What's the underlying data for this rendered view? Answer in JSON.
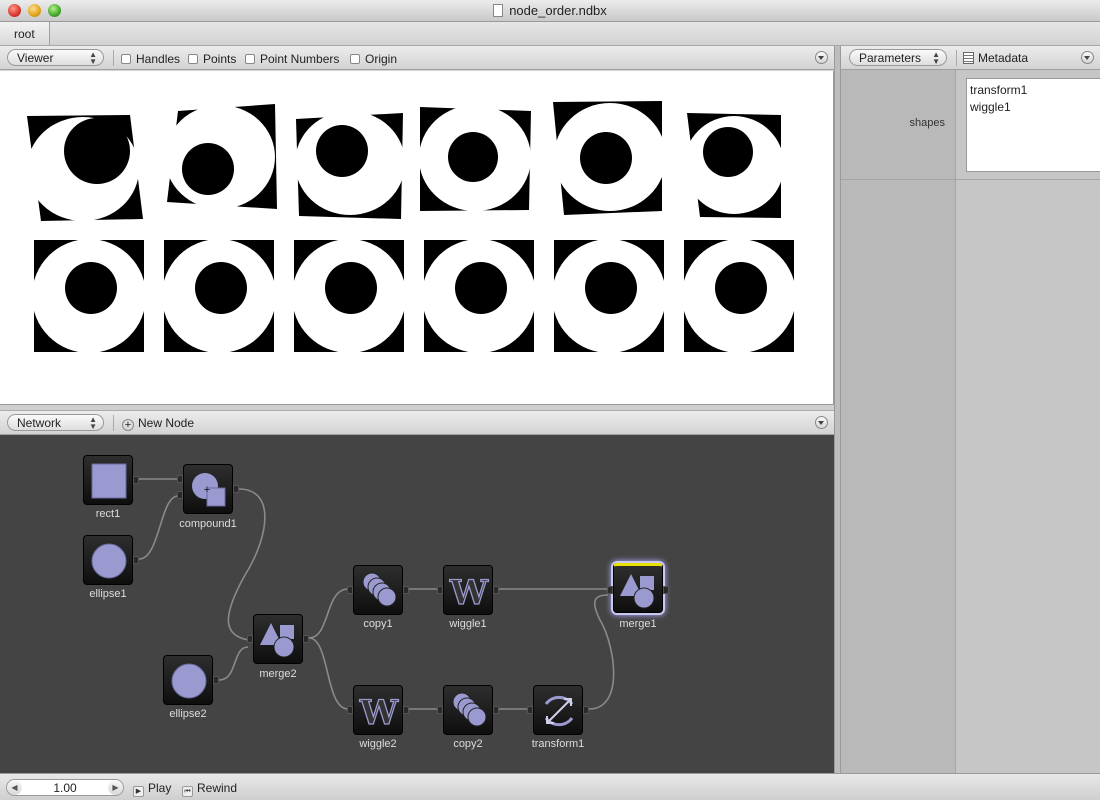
{
  "window": {
    "title": "node_order.ndbx"
  },
  "breadcrumb": {
    "root": "root"
  },
  "viewer": {
    "mode": "Viewer",
    "checkboxes": [
      {
        "label": "Handles",
        "checked": false
      },
      {
        "label": "Points",
        "checked": false
      },
      {
        "label": "Point Numbers",
        "checked": false
      },
      {
        "label": "Origin",
        "checked": false
      }
    ]
  },
  "network": {
    "mode": "Network",
    "new_node": "New Node",
    "nodes": {
      "rect1": "rect1",
      "compound1": "compound1",
      "ellipse1": "ellipse1",
      "ellipse2": "ellipse2",
      "merge2": "merge2",
      "copy1": "copy1",
      "wiggle1": "wiggle1",
      "merge1": "merge1",
      "wiggle2": "wiggle2",
      "copy2": "copy2",
      "transform1": "transform1"
    },
    "selected": "merge1"
  },
  "parameters": {
    "tab_params": "Parameters",
    "tab_meta": "Metadata",
    "shapes_label": "shapes",
    "shapes_items": [
      "transform1",
      "wiggle1"
    ]
  },
  "footer": {
    "frame": "1.00",
    "play": "Play",
    "rewind": "Rewind"
  },
  "colors": {
    "icon": "#9a9ad0",
    "selection": "#e8e000"
  }
}
